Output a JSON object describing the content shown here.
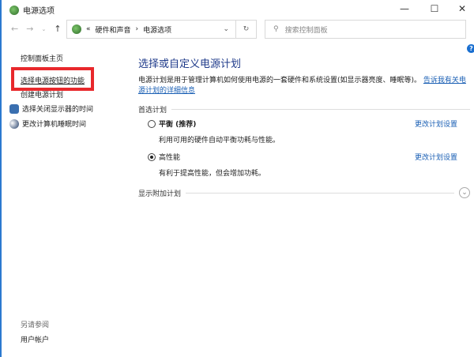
{
  "window": {
    "title": "电源选项",
    "minimize": "—",
    "maximize": "☐",
    "close": "✕"
  },
  "address": {
    "prefix": "«",
    "crumbs": [
      "硬件和声音",
      "电源选项"
    ],
    "sep": "›",
    "search_placeholder": "搜索控制面板"
  },
  "sidebar": {
    "home": "控制面板主页",
    "items": [
      "选择电源按钮的功能",
      "创建电源计划",
      "选择关闭显示器的时间",
      "更改计算机睡眠时间"
    ],
    "see_also": "另请参阅",
    "see_also_items": [
      "用户帐户"
    ]
  },
  "main": {
    "title": "选择或自定义电源计划",
    "desc": "电源计划是用于管理计算机如何使用电源的一套硬件和系统设置(如显示器亮度、睡眠等)。",
    "desc_link": "告诉我有关电源计划的详细信息",
    "preferred": "首选计划",
    "plans": [
      {
        "name": "平衡 (推荐)",
        "desc": "利用可用的硬件自动平衡功耗与性能。",
        "link": "更改计划设置",
        "selected": false
      },
      {
        "name": "高性能",
        "desc": "有利于提高性能，但会增加功耗。",
        "link": "更改计划设置",
        "selected": true
      }
    ],
    "more": "显示附加计划",
    "help": "?"
  }
}
